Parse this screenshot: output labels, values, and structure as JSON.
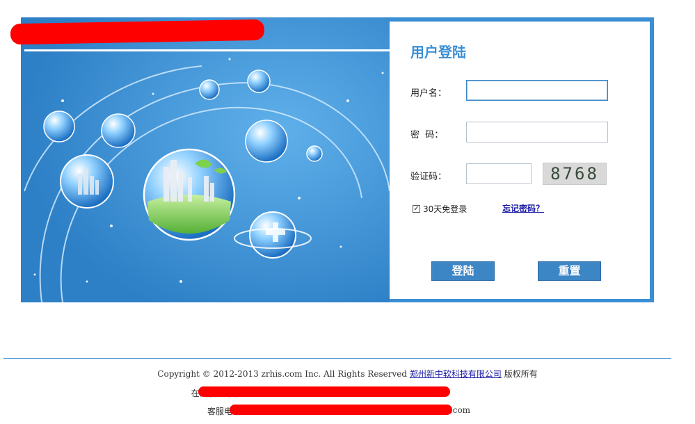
{
  "login": {
    "title": "用户登陆",
    "username_label": "用户名：",
    "password_label": "密  码：",
    "captcha_label": "验证码：",
    "captcha_text": "8768",
    "remember_label": "30天免登录",
    "remember_checked": true,
    "forgot_label": "忘记密码？",
    "login_button": "登陆",
    "reset_button": "重置"
  },
  "footer": {
    "copyright_prefix": "Copyright © 2012-2013 zrhis.com Inc. All Rights Reserved",
    "company_link": "郑州新中软科技有限公司",
    "copyright_suffix": "版权所有",
    "line2_visible": "在线服务QQ：",
    "line3_prefix": "客服电话：",
    "line3_suffix": "@126.com"
  },
  "colors": {
    "accent": "#3a8fd4",
    "button": "#3d86c6",
    "link": "#1a1aa6",
    "redaction": "#ff0000"
  }
}
